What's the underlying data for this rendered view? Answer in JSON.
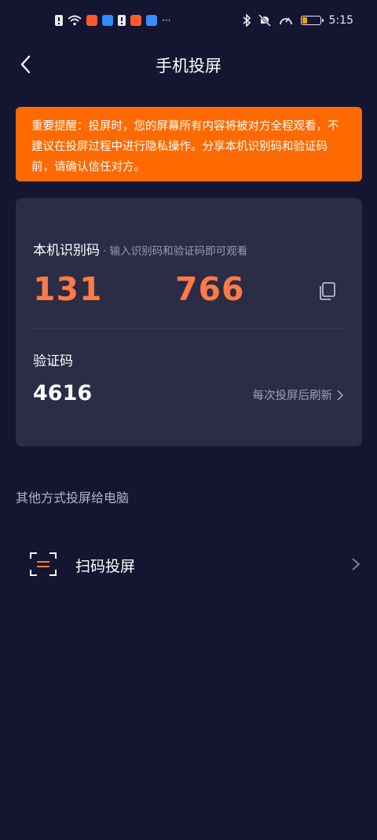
{
  "status_bar": {
    "time": "5:15",
    "overflow": "···",
    "icons": [
      "alert-icon",
      "wifi-icon",
      "app-notification-icon",
      "search-app-icon",
      "alert-icon",
      "app-notification-icon",
      "cloud-app-icon",
      "bluetooth-icon",
      "mute-icon",
      "speedometer-icon",
      "battery-icon"
    ],
    "battery_level": 0.3,
    "battery_color": "#f2a100"
  },
  "header": {
    "title": "手机投屏",
    "back_icon": "chevron-left-icon"
  },
  "warning": {
    "text": "重要提醒：投屏时，您的屏幕所有内容将被对方全程观看，不建议在投屏过程中进行隐私操作。分享本机识别码和验证码前，请确认信任对方。",
    "background": "#ff6a00"
  },
  "device_code": {
    "label": "本机识别码",
    "hint": "· 输入识别码和验证码即可观看",
    "part1": "131",
    "part2": "766",
    "color": "#ff7a45",
    "copy_icon": "copy-icon"
  },
  "verification": {
    "label": "验证码",
    "code": "4616",
    "refresh_text": "每次投屏后刷新"
  },
  "other_methods": {
    "title": "其他方式投屏给电脑",
    "items": [
      {
        "label": "扫码投屏",
        "icon": "scan-icon"
      }
    ]
  }
}
